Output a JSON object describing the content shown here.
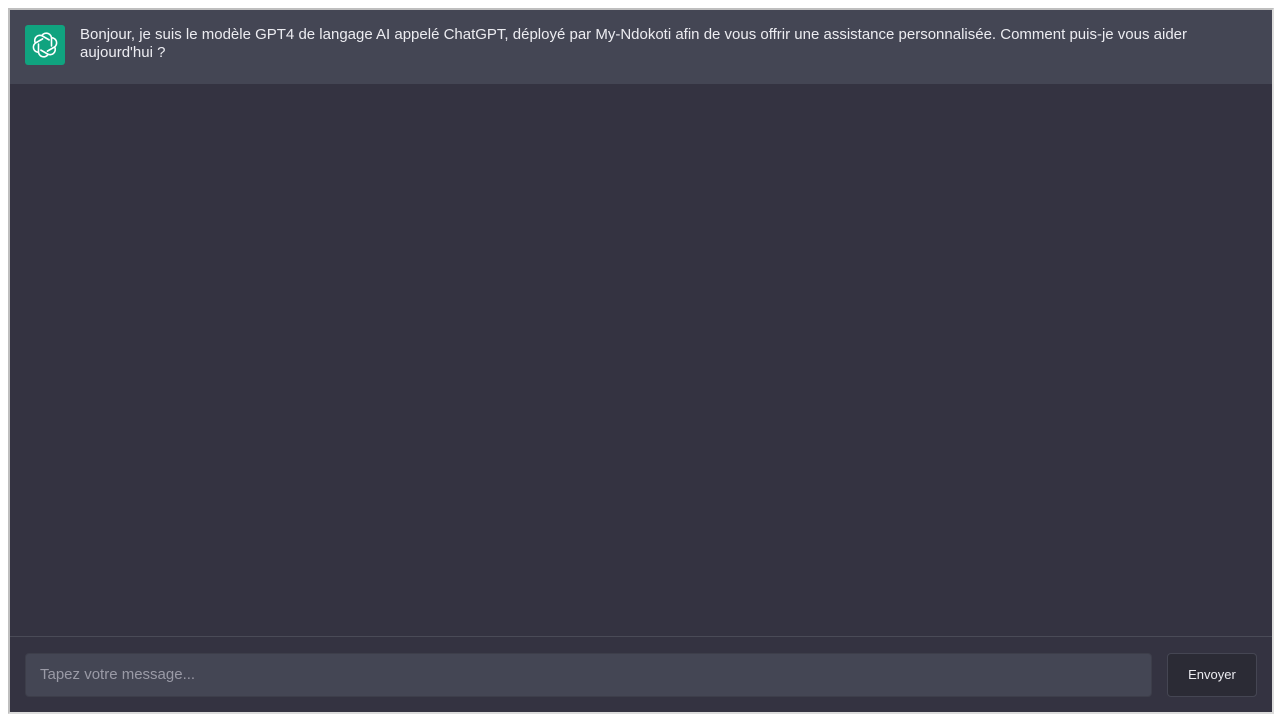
{
  "conversation": {
    "messages": [
      {
        "role": "assistant",
        "icon": "openai-logo-icon",
        "avatar_color": "#10a37f",
        "text": "Bonjour, je suis le modèle GPT4 de langage AI appelé ChatGPT, déployé par My-Ndokoti afin de vous offrir une assistance personnalisée. Comment puis-je vous aider aujourd'hui ?"
      }
    ]
  },
  "composer": {
    "placeholder": "Tapez votre message...",
    "value": "",
    "send_label": "Envoyer"
  },
  "theme": {
    "background": "#343341",
    "message_background": "#444654",
    "accent": "#10a37f"
  }
}
